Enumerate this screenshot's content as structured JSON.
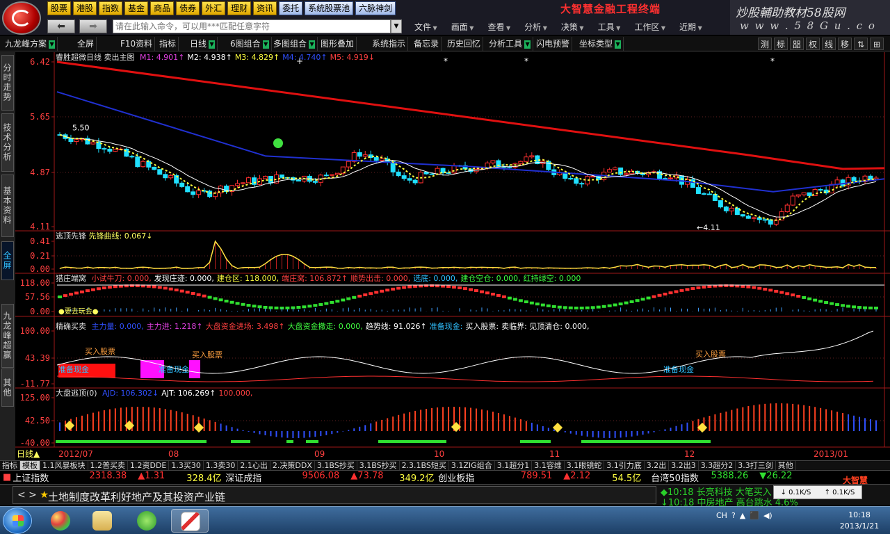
{
  "header": {
    "menu": [
      "股票",
      "港股",
      "指数",
      "基金",
      "商品",
      "债券",
      "外汇",
      "理财",
      "资讯"
    ],
    "menu_blue": [
      "委托",
      "系统股票池",
      "六脉神剑"
    ],
    "brand_title": "大智慧金融工程终端",
    "banner_text": "炒股輔助教材58股网",
    "banner_url": "w w w . 5 8 G u . c o m",
    "command_placeholder": "请在此输入命令，可以用***匹配任意字符",
    "right_menu": [
      "文件",
      "画面",
      "查看",
      "分析",
      "决策",
      "工具",
      "工作区",
      "近期"
    ]
  },
  "toolbar": {
    "items": [
      "九龙峰方案",
      "全屏",
      "F10资料",
      "指标",
      "日线",
      "6图组合",
      "多图组合",
      "图形叠加",
      "系统指示",
      "备忘录",
      "历史回忆",
      "分析工具",
      "闪电预警",
      "坐标类型"
    ],
    "right_buttons": [
      "测",
      "标",
      "㗊",
      "权",
      "线",
      "移",
      "⇅",
      "⊞"
    ]
  },
  "left_tabs": [
    "分时走势",
    "技术分析",
    "基本资料",
    "全屏",
    "九龙峰超赢",
    "其他"
  ],
  "main_chart": {
    "title": "睿胜超微日线",
    "subtitle": "卖出主图",
    "indicators": [
      {
        "label": "M1: 4.901",
        "arrow": "↑",
        "color": "#e040e0"
      },
      {
        "label": "M2: 4.938",
        "arrow": "↑",
        "color": "#ffffff"
      },
      {
        "label": "M3: 4.829",
        "arrow": "↑",
        "color": "#ffff40"
      },
      {
        "label": "M4: 4.740",
        "arrow": "↑",
        "color": "#3050ff"
      },
      {
        "label": "M5: 4.919",
        "arrow": "↓",
        "color": "#ff4040"
      }
    ],
    "yticks": [
      "6.42",
      "5.65",
      "4.87",
      "4.11"
    ],
    "high_label": "5.50",
    "low_label": "4.11"
  },
  "panel1": {
    "title": "逃顶先锋",
    "label": "先锋曲线: 0.067",
    "arrow": "↓",
    "yticks": [
      "0.41",
      "0.21",
      "0.00"
    ]
  },
  "panel2": {
    "title": "猎庄端窝",
    "yticks": [
      "118.00",
      "57.56",
      "0.00"
    ],
    "labels": [
      {
        "t": "小试牛刀: 0.000,",
        "c": "#ff4040"
      },
      {
        "t": "发现庄迹: 0.000,",
        "c": "#ffffff"
      },
      {
        "t": "建仓区: 118.000,",
        "c": "#ffff40"
      },
      {
        "t": "端庄窝: 106.872",
        "c": "#ff4040",
        "a": "↑"
      },
      {
        "t": "顺势出击: 0.000,",
        "c": "#ff4040"
      },
      {
        "t": "选底: 0.000,",
        "c": "#30c0ff"
      },
      {
        "t": "建仓空仓: 0.000,",
        "c": "#40ff40"
      },
      {
        "t": "红持绿空: 0.000",
        "c": "#40ff40"
      }
    ],
    "bottom_label": "●要去玩会●"
  },
  "panel3": {
    "title": "精确买卖",
    "yticks": [
      "100.00",
      "43.39",
      "-11.77"
    ],
    "labels": [
      {
        "t": "主力量: 0.000,",
        "c": "#3050ff"
      },
      {
        "t": "主力进: 1.218",
        "c": "#e040e0",
        "a": "↑"
      },
      {
        "t": "大盘资金进场: 3.498",
        "c": "#ff4040",
        "a": "↑"
      },
      {
        "t": "大盘资金撤走: 0.000,",
        "c": "#40ff40"
      },
      {
        "t": "趋势线: 91.026",
        "c": "#ffffff",
        "a": "↑"
      },
      {
        "t": "准备现金:",
        "c": "#30c0ff"
      },
      {
        "t": "买入股票:",
        "c": "#ffffff"
      },
      {
        "t": "卖临界: 见顶清仓: 0.000,",
        "c": "#ffffff"
      }
    ],
    "buy_labels": [
      "买入股票",
      "买入股票",
      "买入股票"
    ],
    "cash_labels": [
      "准备现金",
      "准备现金",
      "准备现金"
    ]
  },
  "panel4": {
    "title": "大盘逃顶(0)",
    "yticks": [
      "125.00",
      "42.50",
      "-40.00"
    ],
    "labels": [
      {
        "t": "AJD: 106.302",
        "c": "#3050ff",
        "a": "↓"
      },
      {
        "t": "AJT: 106.269",
        "c": "#ffffff",
        "a": "↑"
      },
      {
        "t": "100.000,",
        "c": "#ff4040"
      }
    ]
  },
  "x_axis": [
    "2012/07",
    "08",
    "09",
    "10",
    "11",
    "12",
    "2013/01"
  ],
  "period_label": "日线",
  "indicator_tabs": [
    "指标",
    "模板",
    "1.1风暴板块",
    "1.2普买卖",
    "1.2资DDE",
    "1.3买30",
    "1.3卖30",
    "2.1心出",
    "2.决策DDX",
    "3.1BS抄买",
    "3.1BS抄买",
    "2.3.1BS短买",
    "3.1ZIG组合",
    "3.1超分1",
    "3.1容维",
    "3.1眼镜蛇",
    "3.1引力底",
    "3.2出",
    "3.2出3",
    "3.3超分2",
    "3.3打三剑",
    "其他"
  ],
  "ticker": [
    {
      "name": "上证指数",
      "value": "2318.38",
      "change": "▲1.31",
      "amount": "328.4亿"
    },
    {
      "name": "深证成指",
      "value": "9506.08",
      "change": "▲73.78",
      "amount": "349.2亿"
    },
    {
      "name": "创业板指",
      "value": "789.51",
      "change": "▲2.12",
      "amount": "54.5亿"
    },
    {
      "name": "台湾50指数",
      "value": "5388.26",
      "change": "▼26.22",
      "amount": ""
    }
  ],
  "news": {
    "headline": "土地制度改革利好地产及其投资产业链",
    "right": [
      {
        "t": "◆10:18 长亮科技 大笔买入",
        "c": "#2ad02a"
      },
      {
        "t": "↓10:18 中房地产 高台跳水 4.6%",
        "c": "#2ad02a"
      }
    ],
    "speed": [
      "↓ 0.1K/S",
      "↑ 0.1K/S"
    ],
    "brand": "大智慧"
  },
  "taskbar": {
    "time": "10:18",
    "date": "2013/1/21",
    "tray": [
      "CH",
      "?",
      "▲",
      "⬛",
      "◀)"
    ]
  },
  "colors": {
    "up": "#ff3030",
    "down": "#20e0ff",
    "ma_red": "#e01010",
    "ma_blue": "#2030d0"
  }
}
